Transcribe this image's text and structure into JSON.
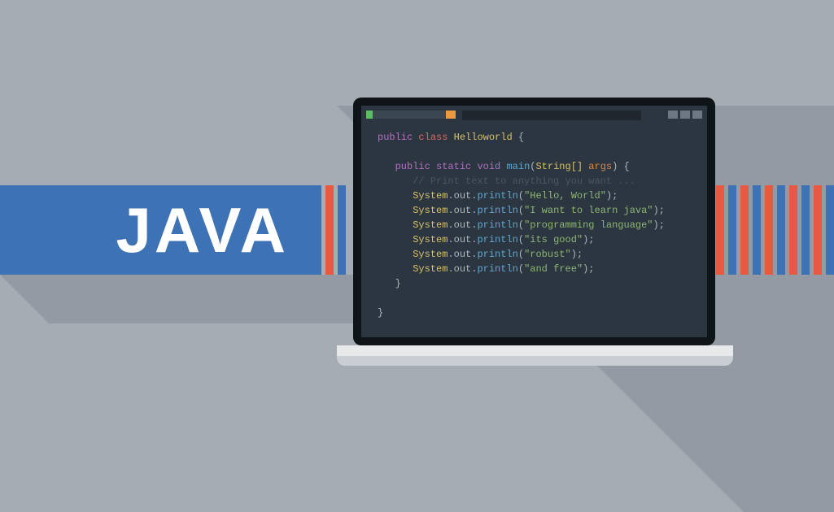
{
  "banner": {
    "title": "JAVA"
  },
  "code": {
    "class_decl": {
      "public": "public",
      "class": "class",
      "name": "Helloworld",
      "open": "{"
    },
    "method": {
      "public": "public",
      "static": "static",
      "void": "void",
      "main": "main",
      "params_open": "(",
      "type": "String[]",
      "arg": "args",
      "params_close": ")",
      "open": "{"
    },
    "comment": "// Print text to anything you want ...",
    "lines": [
      {
        "obj": "System",
        "dot1": ".",
        "out": "out",
        "dot2": ".",
        "method": "println",
        "open": "(",
        "str": "\"Hello, World\"",
        "close": ");"
      },
      {
        "obj": "System",
        "dot1": ".",
        "out": "out",
        "dot2": ".",
        "method": "println",
        "open": "(",
        "str": "\"I want to learn java\"",
        "close": ");"
      },
      {
        "obj": "System",
        "dot1": ".",
        "out": "out",
        "dot2": ".",
        "method": "println",
        "open": "(",
        "str": "\"programming language\"",
        "close": ");"
      },
      {
        "obj": "System",
        "dot1": ".",
        "out": "out",
        "dot2": ".",
        "method": "println",
        "open": "(",
        "str": "\"its good\"",
        "close": ");"
      },
      {
        "obj": "System",
        "dot1": ".",
        "out": "out",
        "dot2": ".",
        "method": "println",
        "open": "(",
        "str": "\"robust\"",
        "close": ");"
      },
      {
        "obj": "System",
        "dot1": ".",
        "out": "out",
        "dot2": ".",
        "method": "println",
        "open": "(",
        "str": "\"and free\"",
        "close": ");"
      }
    ],
    "close_method": "}",
    "close_class": "}"
  }
}
